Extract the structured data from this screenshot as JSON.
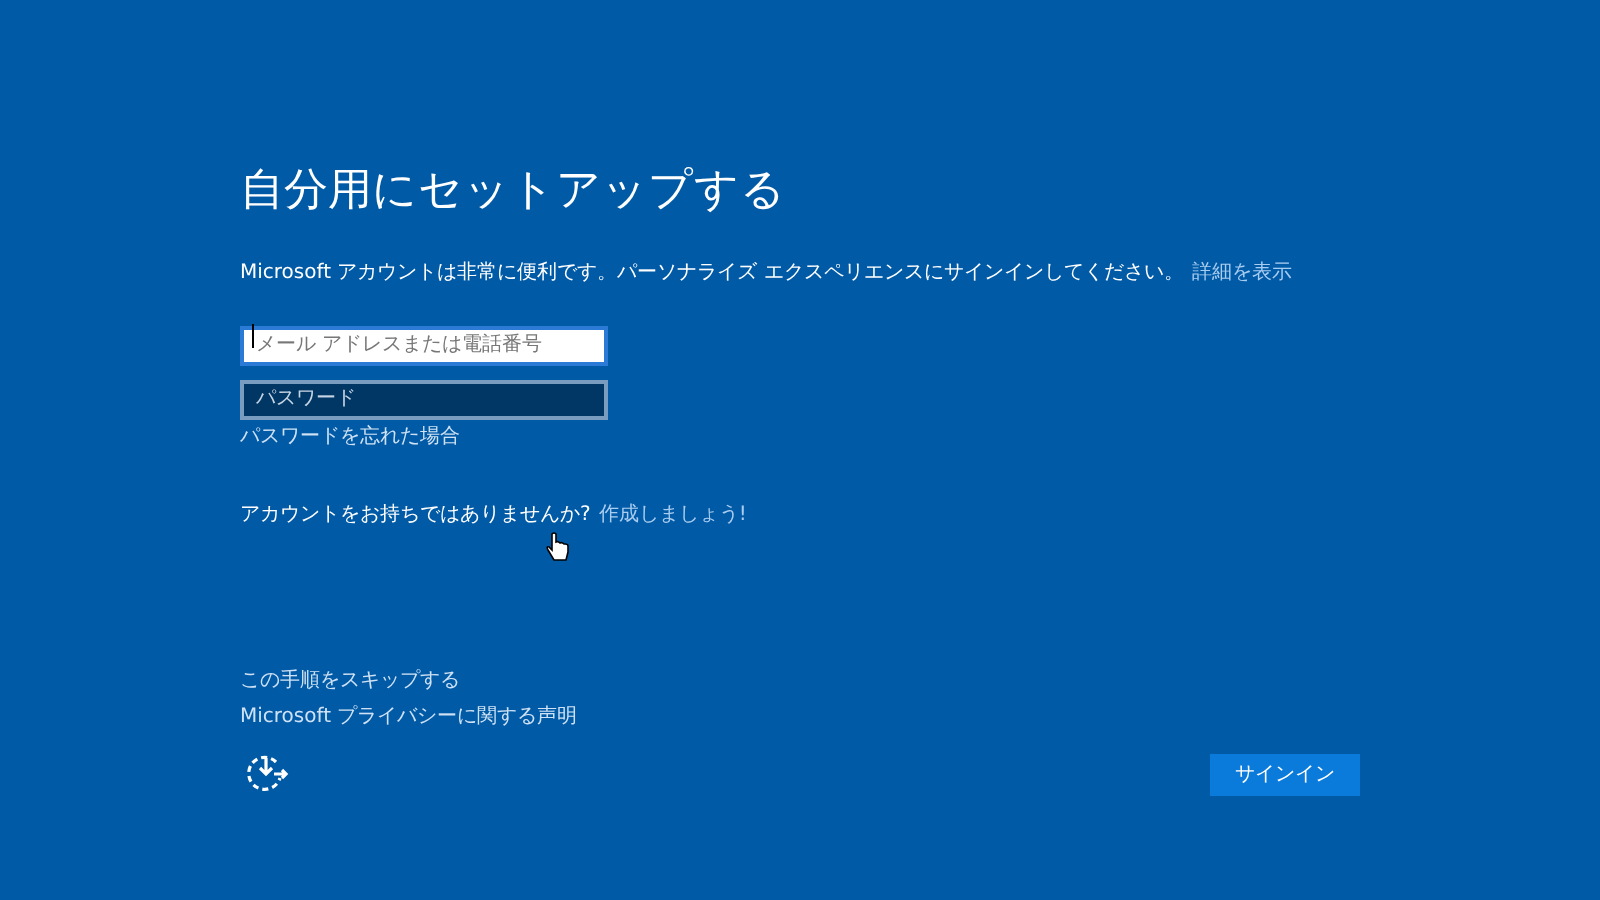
{
  "title": "自分用にセットアップする",
  "intro": {
    "text": "Microsoft アカウントは非常に便利です。パーソナライズ エクスペリエンスにサインインしてください。",
    "link": "詳細を表示"
  },
  "email_field": {
    "placeholder": "メール アドレスまたは電話番号",
    "focused": true
  },
  "password_field": {
    "placeholder": "パスワード",
    "focused": false
  },
  "forgot_password_link": "パスワードを忘れた場合",
  "no_account": {
    "text": "アカウントをお持ちではありませんか?",
    "link": "作成しましょう!"
  },
  "skip_link": "この手順をスキップする",
  "privacy_link": "Microsoft プライバシーに関する声明",
  "sign_in_button": "サインイン"
}
